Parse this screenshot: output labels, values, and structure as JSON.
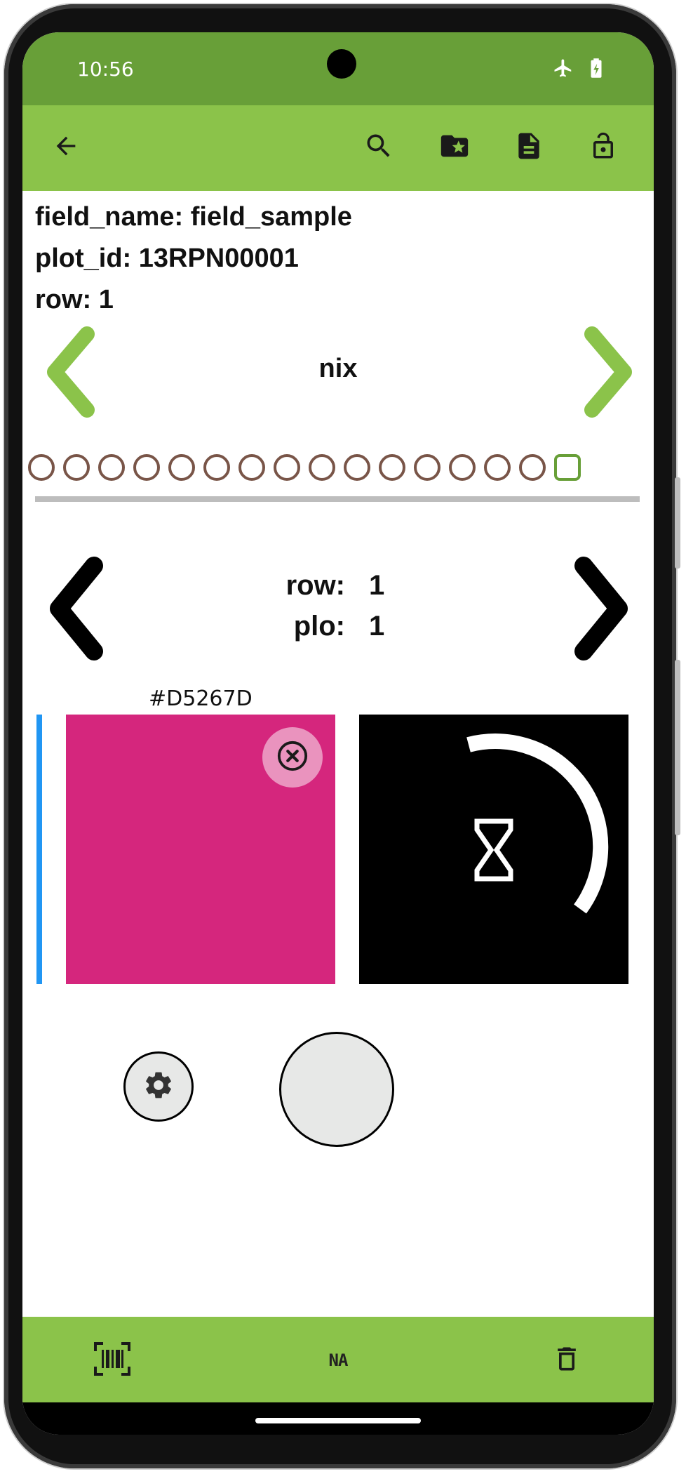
{
  "status_bar": {
    "time": "10:56",
    "icons": [
      "airplane-mode-icon",
      "battery-charging-icon"
    ]
  },
  "toolbar": {
    "icons": [
      "back-arrow-icon",
      "search-icon",
      "folder-star-icon",
      "document-icon",
      "unlock-icon"
    ]
  },
  "info": {
    "field_name": "field_name: field_sample",
    "plot_id": "plot_id: 13RPN00001",
    "row": "row: 1"
  },
  "trait": {
    "name": "nix"
  },
  "progress": {
    "total": 16,
    "current": 16
  },
  "range": {
    "row_key": "row:",
    "row_value": "1",
    "plot_key": "plo:",
    "plot_value": "1"
  },
  "color": {
    "hex_label": "#D5267D",
    "swatch_hex": "#D5267D",
    "accent": "#2196f3"
  },
  "bottom_bar": {
    "na_label": "NA",
    "icons": [
      "barcode-scan-icon",
      "na-icon",
      "delete-icon"
    ]
  },
  "theme": {
    "primary": "#8bc34a",
    "primary_dark": "#689f38",
    "progress_dot": "#795548"
  }
}
